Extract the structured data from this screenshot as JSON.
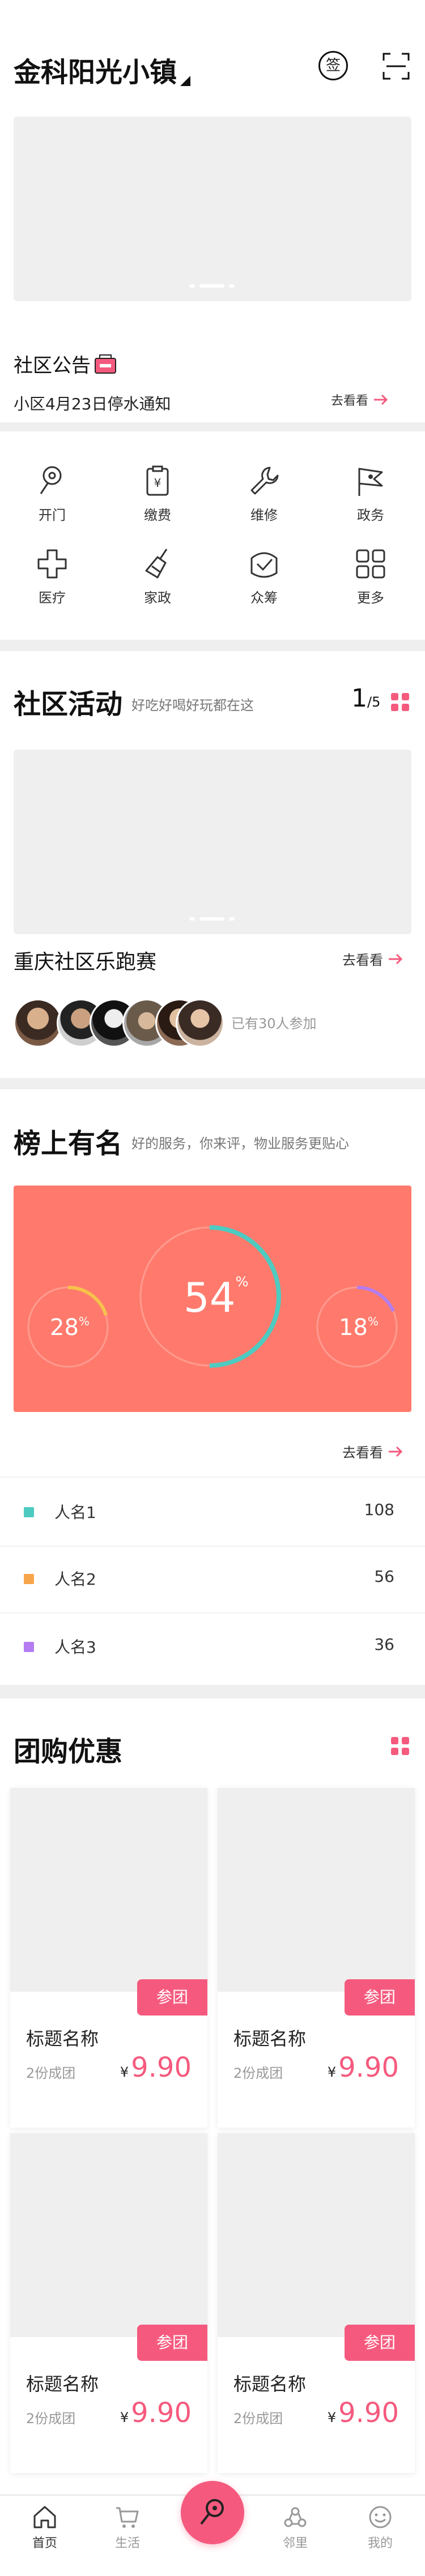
{
  "header": {
    "title": "金科阳光小镇",
    "sign_label": "签"
  },
  "notice": {
    "title": "社区公告",
    "text": "小区4月23日停水通知",
    "more": "去看看"
  },
  "services": [
    {
      "label": "开门",
      "icon": "key-icon"
    },
    {
      "label": "缴费",
      "icon": "payment-icon"
    },
    {
      "label": "维修",
      "icon": "wrench-icon"
    },
    {
      "label": "政务",
      "icon": "flag-icon"
    },
    {
      "label": "医疗",
      "icon": "medical-cross-icon"
    },
    {
      "label": "家政",
      "icon": "broom-icon"
    },
    {
      "label": "众筹",
      "icon": "crowdfund-icon"
    },
    {
      "label": "更多",
      "icon": "grid-icon"
    }
  ],
  "activity": {
    "title": "社区活动",
    "subtitle": "好吃好喝好玩都在这",
    "page_current": "1",
    "page_total": "/5",
    "event_name": "重庆社区乐跑赛",
    "more": "去看看",
    "participants": "已有30人参加"
  },
  "ranking": {
    "title": "榜上有名",
    "subtitle": "好的服务，你来评，物业服务更贴心",
    "center_value": "54",
    "left_value": "28",
    "right_value": "18",
    "percent": "%",
    "more": "去看看",
    "list": [
      {
        "name": "人名1",
        "value": "108",
        "color": "#4ecbc1"
      },
      {
        "name": "人名2",
        "value": "56",
        "color": "#f6a54b"
      },
      {
        "name": "人名3",
        "value": "36",
        "color": "#b47cf0"
      }
    ]
  },
  "group_buy": {
    "title": "团购优惠",
    "items": [
      {
        "join": "参团",
        "name": "标题名称",
        "sub": "2份成团",
        "currency": "¥",
        "price": "9.90"
      },
      {
        "join": "参团",
        "name": "标题名称",
        "sub": "2份成团",
        "currency": "¥",
        "price": "9.90"
      },
      {
        "join": "参团",
        "name": "标题名称",
        "sub": "2份成团",
        "currency": "¥",
        "price": "9.90"
      },
      {
        "join": "参团",
        "name": "标题名称",
        "sub": "2份成团",
        "currency": "¥",
        "price": "9.90"
      }
    ]
  },
  "tabbar": [
    {
      "label": "首页",
      "icon": "home-icon"
    },
    {
      "label": "生活",
      "icon": "cart-icon"
    },
    {
      "label": "",
      "icon": "key-fab-icon"
    },
    {
      "label": "邻里",
      "icon": "neighbors-icon"
    },
    {
      "label": "我的",
      "icon": "smile-icon"
    }
  ],
  "colors": {
    "accent": "#f55a7e",
    "banner": "#ff7a6c",
    "separator": "#efefef"
  }
}
